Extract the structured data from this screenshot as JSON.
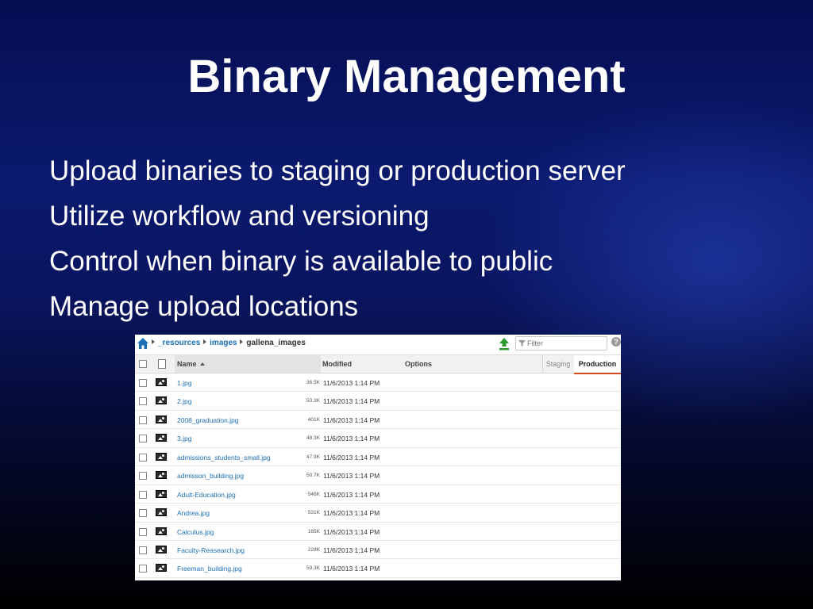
{
  "slide": {
    "title": "Binary Management",
    "bullets": [
      "Upload binaries to staging or production server",
      "Utilize workflow and versioning",
      "Control when binary is available to public",
      "Manage upload locations"
    ]
  },
  "browser": {
    "breadcrumbs": [
      "_resources",
      "images",
      "gallena_images"
    ],
    "filter_placeholder": "Filter",
    "help_label": "?",
    "columns": {
      "name": "Name",
      "modified": "Modified",
      "options": "Options"
    },
    "tabs": {
      "staging": "Staging",
      "production": "Production",
      "active": "Production"
    },
    "files": [
      {
        "name": "1.jpg",
        "size": "36.5K",
        "modified": "11/6/2013 1:14 PM"
      },
      {
        "name": "2.jpg",
        "size": "50.3K",
        "modified": "11/6/2013 1:14 PM"
      },
      {
        "name": "2008_graduation.jpg",
        "size": "401K",
        "modified": "11/6/2013 1:14 PM"
      },
      {
        "name": "3.jpg",
        "size": "48.3K",
        "modified": "11/6/2013 1:14 PM"
      },
      {
        "name": "admissions_students_small.jpg",
        "size": "47.9K",
        "modified": "11/6/2013 1:14 PM"
      },
      {
        "name": "admisson_building.jpg",
        "size": "50.7K",
        "modified": "11/6/2013 1:14 PM"
      },
      {
        "name": "Adult-Education.jpg",
        "size": "546K",
        "modified": "11/6/2013 1:14 PM"
      },
      {
        "name": "Andrea.jpg",
        "size": "531K",
        "modified": "11/6/2013 1:14 PM"
      },
      {
        "name": "Calculus.jpg",
        "size": "165K",
        "modified": "11/6/2013 1:14 PM"
      },
      {
        "name": "Faculty-Reasearch.jpg",
        "size": "228K",
        "modified": "11/6/2013 1:14 PM"
      },
      {
        "name": "Freeman_building.jpg",
        "size": "59.3K",
        "modified": "11/6/2013 1:14 PM"
      }
    ],
    "colors": {
      "link": "#1b6fb5",
      "upload_arrow": "#2e9a2e",
      "home": "#1b6fb5",
      "active_tab_underline": "#d84a1b"
    }
  }
}
